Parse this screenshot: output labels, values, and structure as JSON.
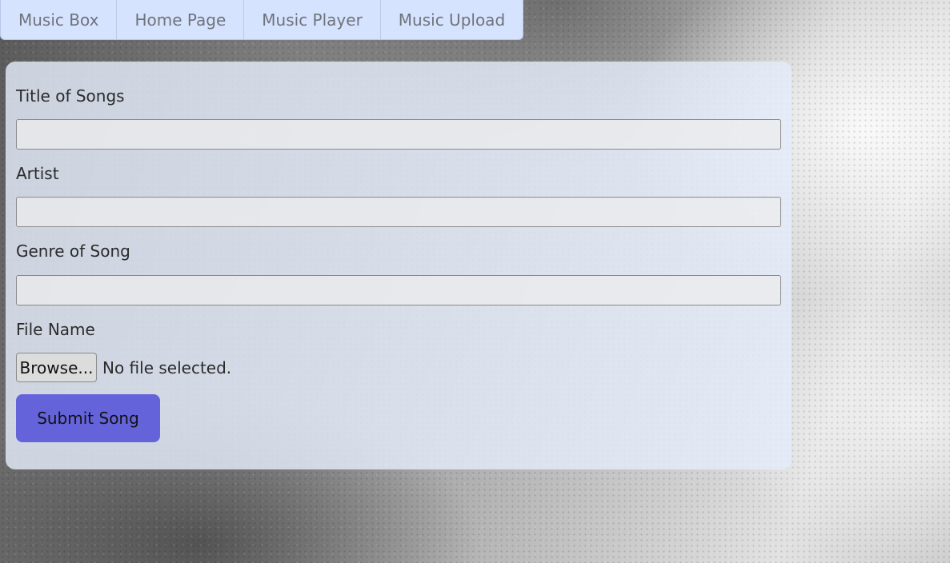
{
  "nav": {
    "items": [
      "Music Box",
      "Home Page",
      "Music Player",
      "Music Upload"
    ]
  },
  "form": {
    "title_label": "Title of Songs",
    "title_value": "",
    "artist_label": "Artist",
    "artist_value": "",
    "genre_label": "Genre of Song",
    "genre_value": "",
    "file_label": "File Name",
    "browse_label": "Browse...",
    "file_status": "No file selected.",
    "submit_label": "Submit Song"
  },
  "colors": {
    "nav_background": "#d6e3ff",
    "card_background": "#e4ebfa",
    "submit_button": "#6563da"
  }
}
